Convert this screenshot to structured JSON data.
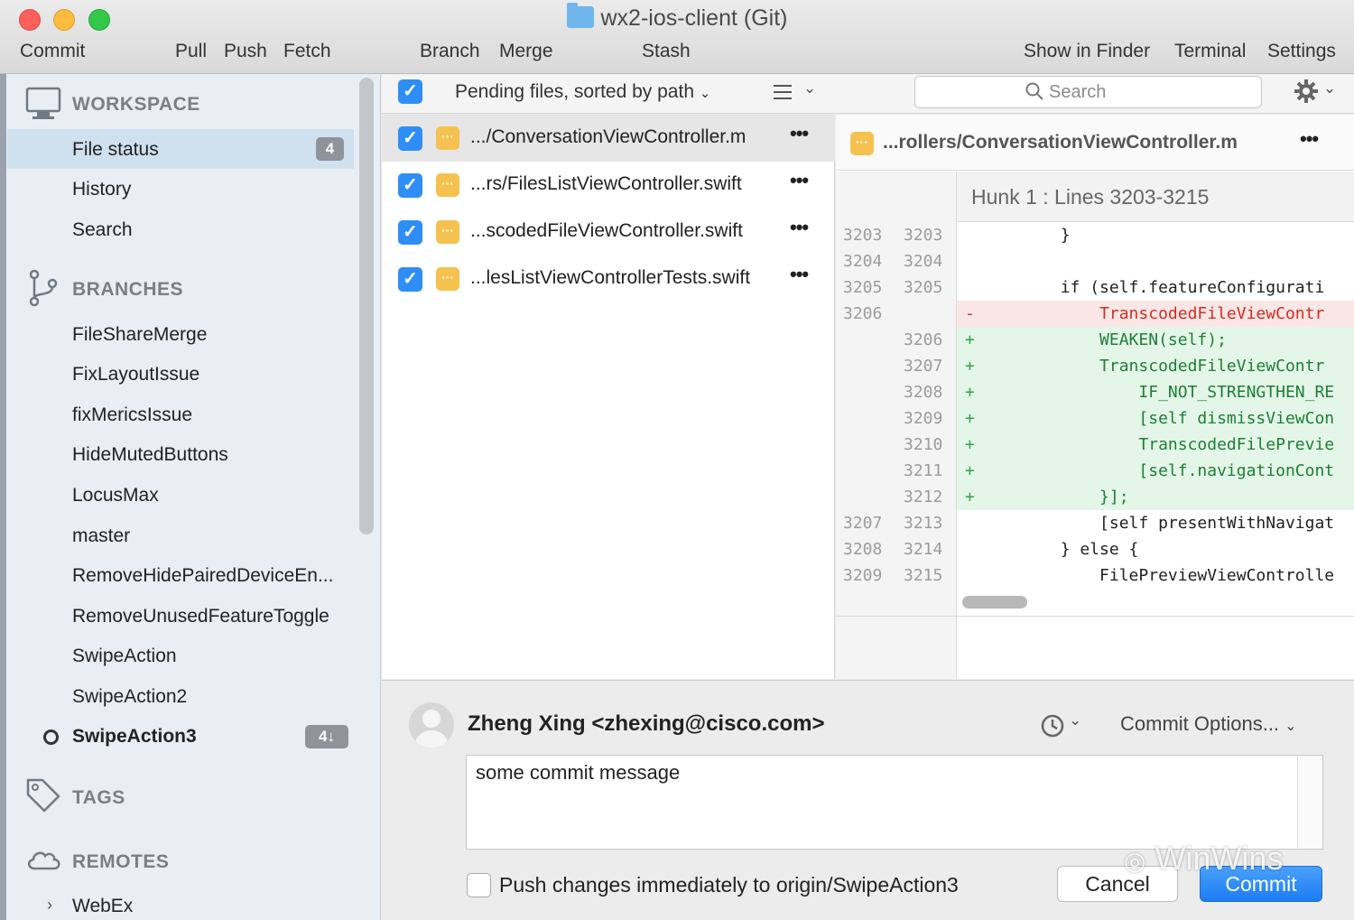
{
  "window": {
    "title": "wx2-ios-client (Git)"
  },
  "toolbar": {
    "commit": "Commit",
    "pull": "Pull",
    "push": "Push",
    "fetch": "Fetch",
    "branch": "Branch",
    "merge": "Merge",
    "stash": "Stash",
    "show_in_finder": "Show in Finder",
    "terminal": "Terminal",
    "settings": "Settings"
  },
  "sidebar": {
    "workspace": {
      "header": "WORKSPACE",
      "items": [
        {
          "label": "File status",
          "badge": "4"
        },
        {
          "label": "History"
        },
        {
          "label": "Search"
        }
      ]
    },
    "branches": {
      "header": "BRANCHES",
      "items": [
        "FileShareMerge",
        "FixLayoutIssue",
        "fixMericsIssue",
        "HideMutedButtons",
        "LocusMax",
        "master",
        "RemoveHidePairedDeviceEn...",
        "RemoveUnusedFeatureToggle",
        "SwipeAction",
        "SwipeAction2"
      ],
      "current": {
        "label": "SwipeAction3",
        "badge": "4↓"
      }
    },
    "tags": {
      "header": "TAGS"
    },
    "remotes": {
      "header": "REMOTES",
      "items": [
        "WebEx"
      ]
    }
  },
  "filelist": {
    "sort_label": "Pending files, sorted by path",
    "files": [
      {
        "name": ".../ConversationViewController.m"
      },
      {
        "name": "...rs/FilesListViewController.swift"
      },
      {
        "name": "...scodedFileViewController.swift"
      },
      {
        "name": "...lesListViewControllerTests.swift"
      }
    ]
  },
  "search": {
    "placeholder": "Search"
  },
  "diff": {
    "file": "...rollers/ConversationViewController.m",
    "hunk_title": "Hunk 1 : Lines 3203-3215",
    "lines": [
      {
        "old": "3203",
        "new": "3203",
        "type": "ctx",
        "text": "        }"
      },
      {
        "old": "3204",
        "new": "3204",
        "type": "ctx",
        "text": ""
      },
      {
        "old": "3205",
        "new": "3205",
        "type": "ctx",
        "text": "        if (self.featureConfigurati"
      },
      {
        "old": "3206",
        "new": "",
        "type": "del",
        "text": "            TranscodedFileViewContr"
      },
      {
        "old": "",
        "new": "3206",
        "type": "add",
        "text": "            WEAKEN(self);"
      },
      {
        "old": "",
        "new": "3207",
        "type": "add",
        "text": "            TranscodedFileViewContr"
      },
      {
        "old": "",
        "new": "3208",
        "type": "add",
        "text": "                IF_NOT_STRENGTHEN_RE"
      },
      {
        "old": "",
        "new": "3209",
        "type": "add",
        "text": "                [self dismissViewCon"
      },
      {
        "old": "",
        "new": "3210",
        "type": "add",
        "text": "                TranscodedFilePrevie"
      },
      {
        "old": "",
        "new": "3211",
        "type": "add",
        "text": "                [self.navigationCont"
      },
      {
        "old": "",
        "new": "3212",
        "type": "add",
        "text": "            }];"
      },
      {
        "old": "3207",
        "new": "3213",
        "type": "ctx",
        "text": "            [self presentWithNavigat"
      },
      {
        "old": "3208",
        "new": "3214",
        "type": "ctx",
        "text": "        } else {"
      },
      {
        "old": "3209",
        "new": "3215",
        "type": "ctx",
        "text": "            FilePreviewViewControlle"
      }
    ]
  },
  "commit": {
    "author": "Zheng Xing <zhexing@cisco.com>",
    "options_label": "Commit Options...",
    "message": "some commit message",
    "push_label": "Push changes immediately to origin/SwipeAction3",
    "cancel_label": "Cancel",
    "commit_label": "Commit"
  },
  "watermark": "WinWins",
  "colors": {
    "accent": "#2f8ef6",
    "added": "#1f7d38",
    "removed": "#d12d20",
    "file_icon": "#f5c14f"
  }
}
